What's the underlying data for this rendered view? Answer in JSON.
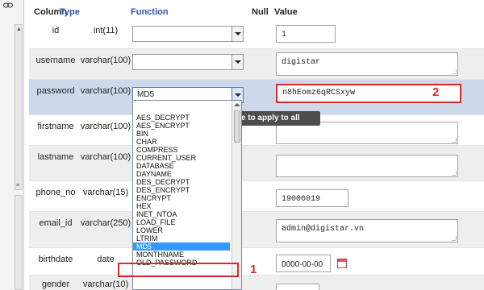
{
  "header": {
    "column": "Column",
    "type": "Type",
    "function": "Function",
    "null": "Null",
    "value": "Value"
  },
  "rows": [
    {
      "name": "id",
      "type": "int(11)",
      "function": "",
      "value": "1"
    },
    {
      "name": "username",
      "type": "varchar(100)",
      "function": "",
      "value": "digistar"
    },
    {
      "name": "password",
      "type": "varchar(100)",
      "function": "MD5",
      "value": "n8hEomz6qRCSxyw"
    },
    {
      "name": "firstname",
      "type": "varchar(100)",
      "function": "",
      "value": ""
    },
    {
      "name": "lastname",
      "type": "varchar(100)",
      "function": "",
      "value": ""
    },
    {
      "name": "phone_no",
      "type": "varchar(15)",
      "function": "",
      "value": "19006019"
    },
    {
      "name": "email_id",
      "type": "varchar(250)",
      "function": "",
      "value": "admin@digistar.vn"
    },
    {
      "name": "birthdate",
      "type": "date",
      "function": "",
      "value": "0000-00-00"
    },
    {
      "name": "gender",
      "type": "varchar(10)",
      "function": "",
      "value": ""
    }
  ],
  "tooltip": "me to apply to all",
  "dropdown": {
    "options": [
      "AES_DECRYPT",
      "AES_ENCRYPT",
      "BIN",
      "CHAR",
      "COMPRESS",
      "CURRENT_USER",
      "DATABASE",
      "DAYNAME",
      "DES_DECRYPT",
      "DES_ENCRYPT",
      "ENCRYPT",
      "HEX",
      "INET_NTOA",
      "LOAD_FILE",
      "LOWER",
      "LTRIM",
      "MD5",
      "MONTHNAME",
      "OLD_PASSWORD"
    ],
    "selected": "MD5"
  },
  "annotations": {
    "one": "1",
    "two": "2"
  },
  "colors": {
    "highlight_row": "#cdd9ea",
    "annotation_red": "#e0262b",
    "selected_option": "#3399ff",
    "link_blue": "#2a55aa"
  },
  "icons": [
    "link-icon",
    "calendar-icon",
    "scroll-up-icon",
    "dropdown-arrow-icon"
  ]
}
